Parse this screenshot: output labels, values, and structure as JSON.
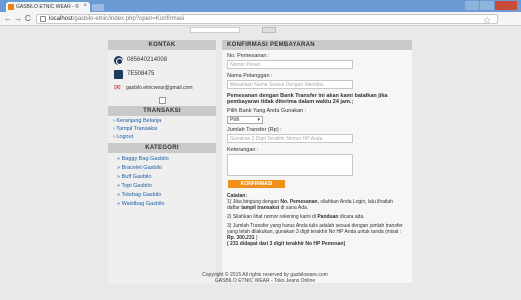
{
  "browser": {
    "tab_title": "GASBILO ETNIC WEAR - ©",
    "tab_close": "×",
    "url_host": "localhost",
    "url_path": "/gasbilo-etnic/index.php?open=Konfirmasi",
    "back": "←",
    "forward": "→",
    "reload": "C",
    "star": "☆"
  },
  "sidebar": {
    "kontak_title": "KONTAK",
    "phone": "085640214008",
    "bb": "7E508475",
    "email": "gasbilo.etnicwear@gmail.com",
    "transaksi_title": "TRANSAKSI",
    "menu": [
      "Keranjang Belanja",
      "Tampil Transaksi",
      "Logout"
    ],
    "kategori_title": "KATEGORI",
    "categories": [
      "Baggy Bag Gasbilo",
      "Bracelet Gasbilo",
      "Buff Gasbilo",
      "Topi Gasbilo",
      "Totebag Gasbilo",
      "Waistbag Gasbilo"
    ]
  },
  "form": {
    "title": "KONFIRMASI PEMBAYARAN",
    "no_pemesanan_label": "No. Pemesanan :",
    "no_pemesanan_placeholder": "Nomor Pesan",
    "nama_label": "Nama Pelanggan :",
    "nama_placeholder": "Masukkan Nama Sesuai Dengan Identitas",
    "notice": "Pemesanan dengan Bank Transfer ini akan kami batalkan jika pembayaran tidak diterima dalam waktu 24 jam.;",
    "bank_label": "Pilih Bank Yang Anda Gunakan :",
    "bank_value": "Pilih",
    "jumlah_label": "Jumlah Transfer (Rp) :",
    "jumlah_placeholder": "Gunakan 3 Digit Terakhir Nomor HP Anda",
    "keterangan_label": "Keterangan :",
    "submit": "KONFIRMASI PESANAN"
  },
  "catatan": {
    "title": "Catatan:",
    "p1a": "1) Jika bingung dengan ",
    "p1b": "No. Pemesanan",
    "p1c": ", silahkan Anda Login, lalu lihatlah daftar ",
    "p1d": "tampil transaksi",
    "p1e": " di sana Ada.",
    "p2a": "2) Silahkan lihat nomor rekening kami di ",
    "p2b": "Panduan",
    "p2c": " dicara ada.",
    "p3a": "3) Jumlah Transfer yang harus Anda tulis adalah sesuai dengan jumlah transfer yang telah dilakukan, gunakan 3 digit terakhir No HP Anda untuk tanda (misal : ",
    "p3b": "Rp. 300.231",
    "p3c": " )",
    "p3d": "( 231 didapat dari 3 digit terakhir No HP Pemesan)"
  },
  "footer": {
    "line1": "Copyright © 2015 All rights reserved by gasbiloware.com",
    "line2": "GASBILO ETNIC WEAR - Toko Jeans Online"
  },
  "colors": {
    "accent_orange": "#f0901c",
    "link_blue": "#1f5ea8",
    "chrome_blue": "#6a9bd3"
  }
}
